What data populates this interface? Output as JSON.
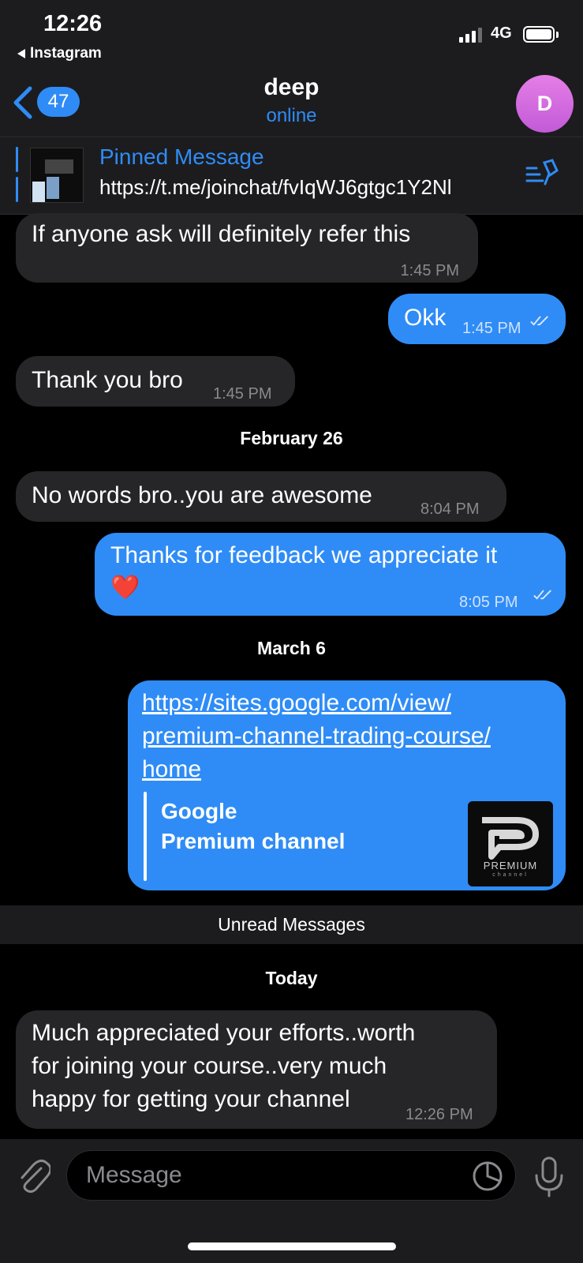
{
  "status": {
    "time": "12:26",
    "back_app": "Instagram",
    "network": "4G"
  },
  "header": {
    "unread_count": "47",
    "title": "deep",
    "subtitle": "online",
    "avatar_letter": "D"
  },
  "pinned": {
    "label": "Pinned Message",
    "text": "https://t.me/joinchat/fvIqWJ6gtgc1Y2Nl"
  },
  "messages": [
    {
      "dir": "in",
      "text": "If anyone ask will definitely refer this",
      "time": "1:45 PM"
    },
    {
      "dir": "out",
      "text": "Okk",
      "time": "1:45 PM"
    },
    {
      "dir": "in",
      "text": "Thank you bro",
      "time": "1:45 PM"
    },
    {
      "dir": "in",
      "text": "No words bro..you are awesome",
      "time": "8:04 PM"
    },
    {
      "dir": "out",
      "text": "Thanks for feedback we appreciate it",
      "emoji": "❤️",
      "time": "8:05 PM"
    },
    {
      "dir": "out",
      "link_line1": "https://sites.google.com/view/",
      "link_line2": "premium-channel-trading-course/",
      "link_line3": "home",
      "preview_site": "Google",
      "preview_title": "Premium channel",
      "preview_logo_text": "PREMIUM",
      "preview_logo_sub": "channel"
    },
    {
      "dir": "in",
      "line1": "Much appreciated your efforts..worth",
      "line2": "for joining your course..very much",
      "line3": "happy for getting your channel",
      "time": "12:26 PM"
    }
  ],
  "dates": {
    "d1": "February 26",
    "d2": "March 6",
    "d3": "Today"
  },
  "unread_label": "Unread Messages",
  "input": {
    "placeholder": "Message"
  },
  "icons": {
    "back": "chevron-left-icon",
    "pin": "pin-list-icon",
    "attach": "paperclip-icon",
    "sticker": "sticker-icon",
    "mic": "microphone-icon",
    "read": "double-check-icon"
  },
  "colors": {
    "accent": "#2f8cf6",
    "incoming": "#262628",
    "background": "#000000",
    "bar": "#1c1c1e"
  }
}
